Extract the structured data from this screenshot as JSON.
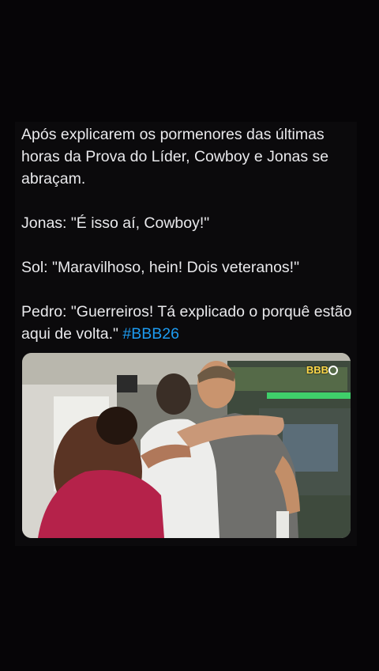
{
  "post": {
    "paragraph1": "Após explicarem os pormenores das últimas horas da Prova do Líder, Cowboy e Jonas se abraçam.",
    "paragraph2": "Jonas: \"É isso aí, Cowboy!\"",
    "paragraph3": "Sol: \"Maravilhoso, hein! Dois veteranos!\"",
    "paragraph4": "Pedro: \"Guerreiros! Tá explicado o porquê estão aqui de volta.\"",
    "hashtag": "#BBB26"
  },
  "media": {
    "watermark": "BBB"
  },
  "colors": {
    "background": "#060507",
    "text": "#e9e9ec",
    "hashtag": "#1d9bf0"
  }
}
